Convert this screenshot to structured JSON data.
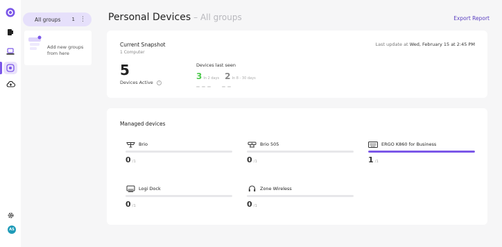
{
  "header": {
    "title": "Personal Devices",
    "subtitle": "– All groups",
    "export_label": "Export Report"
  },
  "groups_panel": {
    "all_groups": {
      "label": "All groups",
      "count": "1",
      "menu_glyph": "⋮"
    },
    "add_card_text": "Add new groups from here"
  },
  "snapshot": {
    "title": "Current Snapshot",
    "subtitle": "1 Computer",
    "last_update_label": "Last update at",
    "last_update_value": "Wed, February 15 at 2:45 PM",
    "active_count": "5",
    "active_label": "Devices Active",
    "info_glyph": "i",
    "last_seen_title": "Devices last seen",
    "last_seen": [
      {
        "count": "3",
        "label": "In 2 days",
        "color": "#4fc94f"
      },
      {
        "count": "2",
        "label": "In 8 - 30 days",
        "color": "#888888"
      }
    ]
  },
  "managed": {
    "title": "Managed devices",
    "devices": [
      {
        "name": "Brio",
        "icon": "webcam-icon",
        "count": "0",
        "of": "/1",
        "fill": 0
      },
      {
        "name": "Brio 505",
        "icon": "webcam-icon",
        "count": "0",
        "of": "/1",
        "fill": 0
      },
      {
        "name": "ERGO K860 for Business",
        "icon": "keyboard-icon",
        "count": "1",
        "of": "/1",
        "fill": 1
      },
      {
        "name": "Logi Dock",
        "icon": "dock-icon",
        "count": "0",
        "of": "/1",
        "fill": 0
      },
      {
        "name": "Zone Wireless",
        "icon": "headset-icon",
        "count": "0",
        "of": "/1",
        "fill": 0
      }
    ]
  },
  "user": {
    "initials": "AS"
  },
  "colors": {
    "accent": "#7b57e8",
    "green": "#4fc94f",
    "avatar": "#1f9bb8"
  }
}
